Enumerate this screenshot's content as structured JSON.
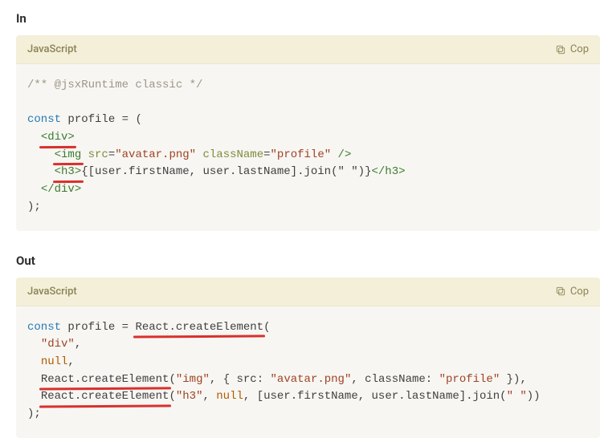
{
  "sections": {
    "in": {
      "heading": "In",
      "lang": "JavaScript",
      "copy_label": "Cop",
      "code": {
        "comment": "/** @jsxRuntime classic */",
        "kw_const": "const",
        "var": "profile",
        "eq": "=",
        "open_paren": "(",
        "tag_div_open": "<div>",
        "tag_img_open": "<img",
        "attr_src": "src",
        "val_src": "\"avatar.png\"",
        "attr_cls": "className",
        "val_cls": "\"profile\"",
        "img_close": "/>",
        "tag_h3_open": "<h3>",
        "h3_expr": "{[user.firstName, user.lastName].join(\" \")}",
        "tag_h3_close": "</h3>",
        "tag_div_close": "</div>",
        "close": ");"
      }
    },
    "out": {
      "heading": "Out",
      "lang": "JavaScript",
      "copy_label": "Cop",
      "code": {
        "kw_const": "const",
        "var": "profile",
        "eq": "=",
        "fn1": "React.createElement",
        "open1": "(",
        "arg_div": "\"div\"",
        "comma": ",",
        "arg_null": "null",
        "fn2": "React.createElement",
        "open2": "(",
        "arg_img": "\"img\"",
        "obj_open": "{ ",
        "k_src": "src",
        "colon": ":",
        "v_src": "\"avatar.png\"",
        "k_cls": "className",
        "v_cls": "\"profile\"",
        "obj_close": " }",
        "close2": "),",
        "fn3": "React.createElement",
        "open3": "(",
        "arg_h3": "\"h3\"",
        "arg_null2": "null",
        "arr": "[user.firstName, user.lastName].join(",
        "arr_sp": "\" \"",
        "arr_close": "))",
        "final_close": ");"
      }
    }
  }
}
